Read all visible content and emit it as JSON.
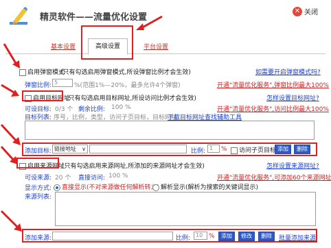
{
  "window": {
    "title": "精灵软件——流量优化设置",
    "close_label": "关闭"
  },
  "tabs": [
    {
      "label": "基本设置"
    },
    {
      "label": "高级设置"
    },
    {
      "label": "平台设置"
    }
  ],
  "popup": {
    "checkbox_label": "启用弹窗模式",
    "note": "(只有勾选启用弹窗模式,所设弹窗比例才会生效)",
    "help_link": "如需要开启弹窗模式吗?",
    "ratio_label": "弹窗比例:",
    "ratio_value": "5",
    "ratio_hint": "%(范围1%—20%，最多允许4个弹窗)",
    "upsell_link": "开通\"流量优化服务\",弹窗比例最大100%"
  },
  "target": {
    "checkbox_label": "启用目标网址",
    "note": "(只有勾选启用目标网址,所设访问比例才会生效)",
    "help_link": "怎样设置目标网址?",
    "settable_label": "可设目标:",
    "settable_value": "0/3 个",
    "remaining_label": "剩余比例:",
    "remaining_value": "100 %",
    "upsell_link": "开通\"流量优化服务\",访问比例最大100%",
    "list_label": "目标列表:",
    "list_columns": "序号，比例，类型，访问子页目标，目标网址",
    "tool_link": "下载目标网址查找辅助工具",
    "add_label": "添加目标:",
    "select_value": "链接地址",
    "ratio_label": "比例:",
    "ratio_value": "1",
    "percent": "%",
    "subpage_label": "访问子页目标",
    "add_button": "添加",
    "delete_button": "删除"
  },
  "source": {
    "checkbox_label": "启用来源网址",
    "note": "(只有勾选启用来源网址,所添加的来源网址才会生效)",
    "help_link": "怎样设置来源网址?",
    "settable_label": "可设来源:",
    "settable_value": "20 个",
    "direct_label": "直接访问:",
    "direct_value": "100 %",
    "upsell_link": "开通\"流量优化服务\",可添加60个来源网址",
    "display_label": "显示方式:",
    "option_direct": "直接显示(不对来源做任何解析转义)",
    "option_parse": "解析显示(解析为搜索的关键词显示)",
    "list_label": "来源列表:",
    "add_label": "添加来源:",
    "ratio_label": "比例:",
    "ratio_value": "10",
    "percent": "%",
    "add_button": "添加",
    "edit_button": "修改",
    "delete_button": "删除",
    "batch_link": "批量添加来源"
  }
}
